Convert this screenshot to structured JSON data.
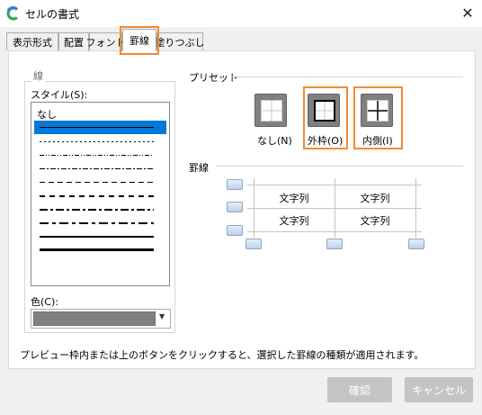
{
  "window": {
    "title": "セルの書式",
    "close": "✕"
  },
  "tabs": [
    {
      "label": "表示形式"
    },
    {
      "label": "配置"
    },
    {
      "label": "フォント"
    },
    {
      "label": "罫線",
      "active": true
    },
    {
      "label": "塗りつぶし"
    }
  ],
  "line": {
    "caption": "線",
    "style_label": "スタイル(S):",
    "style_none": "なし",
    "styles": [
      "thin-solid",
      "dotted",
      "dash-dot-dot",
      "dash-dot",
      "dashed",
      "medium-dashed",
      "medium-dash-dot",
      "medium-solid",
      "thick-solid"
    ],
    "selected_style": "thin-solid",
    "color_label": "色(C):",
    "color_value": "#808080"
  },
  "presets": {
    "caption": "プリセット",
    "items": [
      {
        "label": "なし(N)",
        "icon": "preset-none-icon",
        "highlighted": false
      },
      {
        "label": "外枠(O)",
        "icon": "preset-outline-icon",
        "highlighted": true
      },
      {
        "label": "内側(I)",
        "icon": "preset-inside-icon",
        "highlighted": true
      }
    ]
  },
  "border": {
    "caption": "罫線",
    "cells": [
      "文字列",
      "文字列",
      "文字列",
      "文字列"
    ]
  },
  "description": "プレビュー枠内または上のボタンをクリックすると、選択した罫線の種類が適用されます。",
  "buttons": {
    "ok": "確認",
    "cancel": "キャンセル"
  },
  "colors": {
    "highlight": "#f08c33",
    "selection": "#0078d7",
    "button_disabled": "#c4c4c4"
  }
}
